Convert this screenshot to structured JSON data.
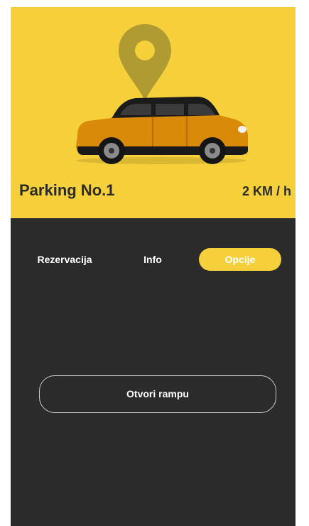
{
  "hero": {
    "title": "Parking No.1",
    "speed": "2 KM / h",
    "background_color": "#f5d03b",
    "pin_icon": "map-pin-icon",
    "car_image": "orange-hatchback-car"
  },
  "tabs": [
    {
      "label": "Rezervacija",
      "active": false
    },
    {
      "label": "Info",
      "active": false
    },
    {
      "label": "Opcije",
      "active": true
    }
  ],
  "actions": {
    "open_ramp_label": "Otvori rampu"
  },
  "colors": {
    "accent": "#f5d03b",
    "panel": "#2b2b2b",
    "text_dark": "#2b2b2b",
    "text_light": "#ffffff"
  }
}
